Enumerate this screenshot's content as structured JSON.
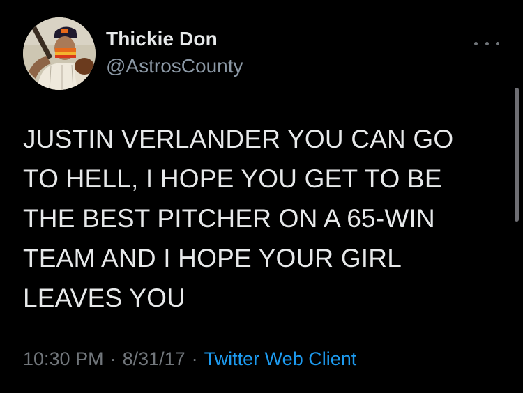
{
  "tweet": {
    "author": {
      "display_name": "Thickie Don",
      "handle": "@AstrosCounty"
    },
    "text": "JUSTIN VERLANDER YOU CAN GO\nTO HELL, I HOPE YOU GET TO BE\nTHE BEST PITCHER ON A 65-WIN\nTEAM AND I HOPE YOUR GIRL\nLEAVES YOU",
    "time": "10:30 PM",
    "separator": "·",
    "date": "8/31/17",
    "client": "Twitter Web Client"
  },
  "colors": {
    "background": "#000000",
    "text_primary": "#e7e9ea",
    "text_secondary": "#71767b",
    "link": "#1d9bf0"
  },
  "icons": {
    "more": "more-horizontal-icon"
  }
}
